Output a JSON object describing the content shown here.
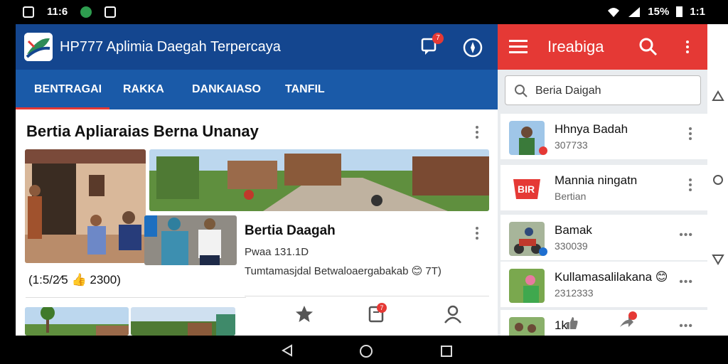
{
  "status_bar": {
    "time": "11:6",
    "battery_text": "15%",
    "carrier_text": "1:1"
  },
  "app": {
    "title": "HP777 Aplimia Daegah Terpercaya",
    "chat_badge": "7",
    "tabs": [
      "BENTRAGAI",
      "RAKKA",
      "DANKAIASO",
      "TANFIL"
    ],
    "section_title": "Bertia Apliaraias Berna Unanay",
    "card": {
      "title": "Bertia Daagah",
      "meta": "Pwaa 131.1D",
      "desc": "Tumtamasjdal Betwaloaergabakab 😊 7T)"
    },
    "caption": "(1:5/2⁄5 👍 2300)",
    "bottom_nav_badge": "7"
  },
  "side": {
    "title": "Ireabiga",
    "search_value": "Beria Daigah",
    "items": [
      {
        "name": "Hhnya Badah",
        "sub": "307733"
      },
      {
        "name": "Mannia ningatn",
        "sub": "Bertian",
        "logo_text": "BIR"
      },
      {
        "name": "Bamak",
        "sub": "330039"
      },
      {
        "name": "Kullamasalilakana 😊",
        "sub": "2312333"
      },
      {
        "name": "1k",
        "sub": ""
      }
    ]
  },
  "colors": {
    "appbar": "#14468f",
    "tabbar": "#1a5aa8",
    "accent_red": "#e53935"
  }
}
